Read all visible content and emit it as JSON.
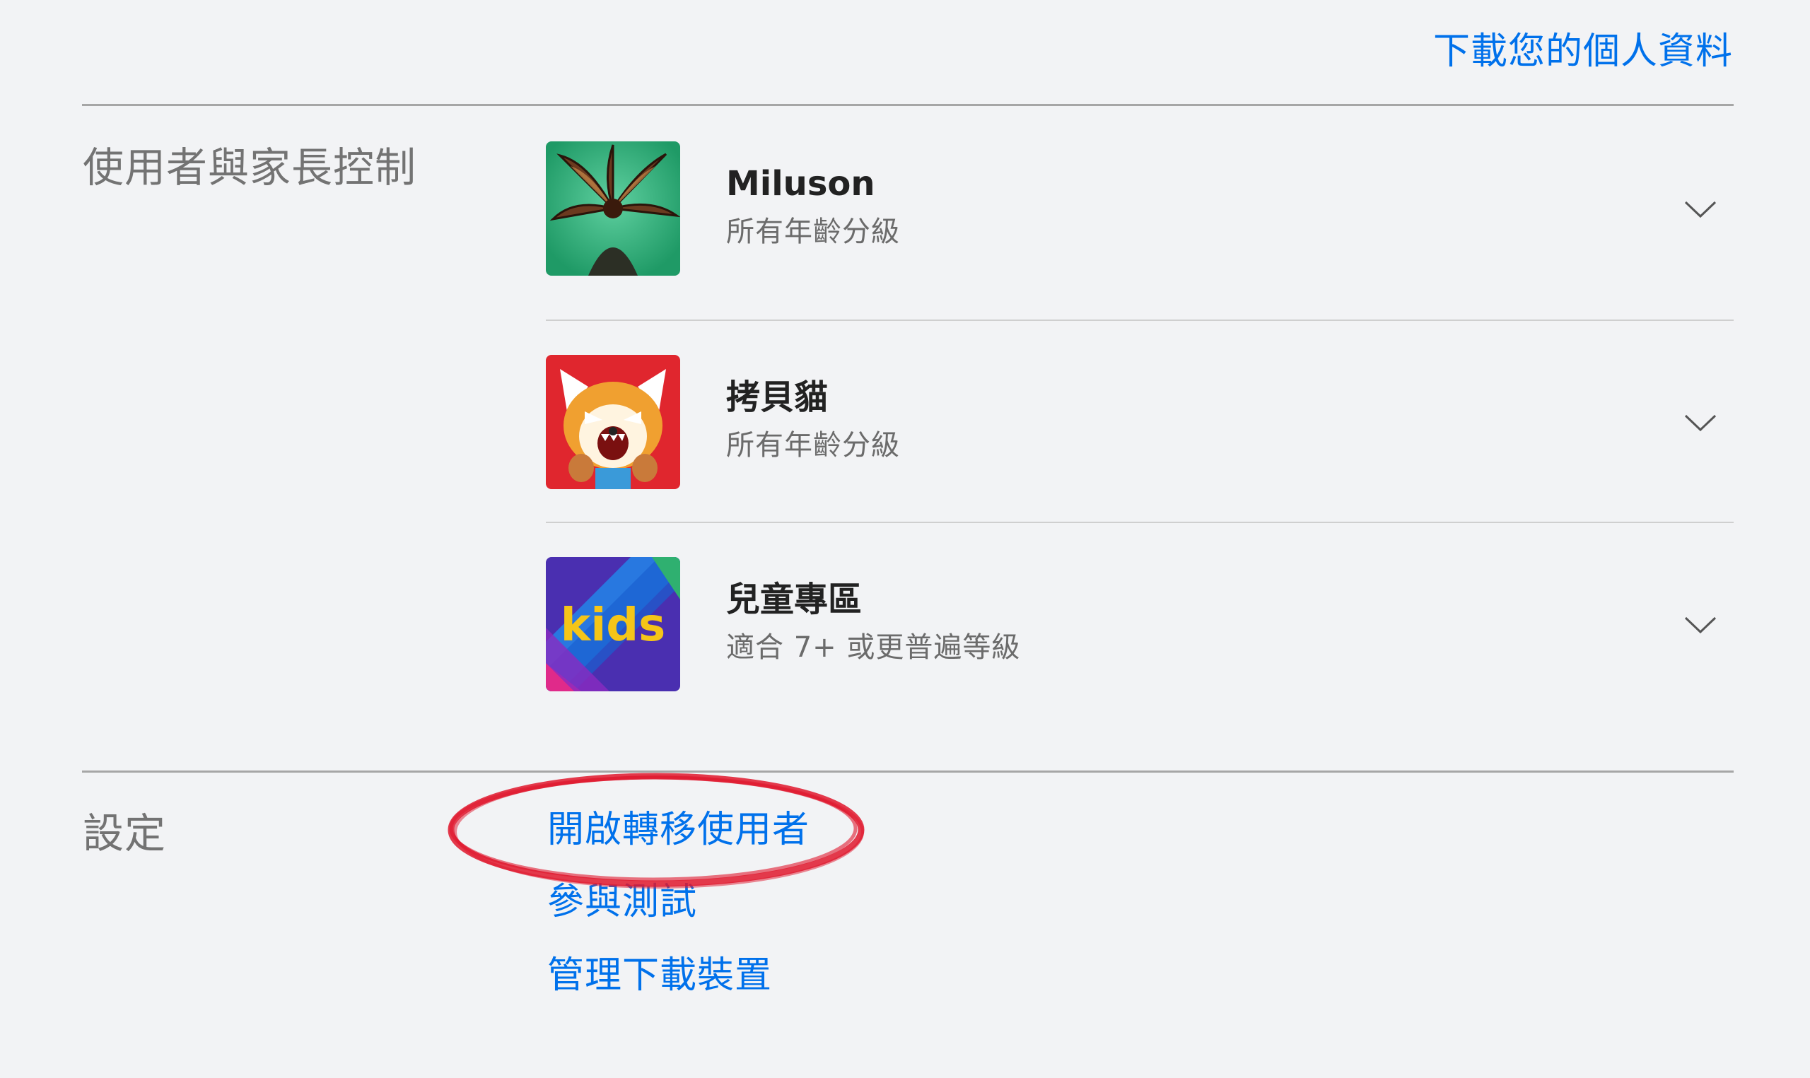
{
  "header": {
    "download_link": "下載您的個人資料"
  },
  "profiles_section": {
    "label": "使用者與家長控制",
    "profiles": [
      {
        "name": "Miluson",
        "rating": "所有年齡分級",
        "avatar": "monster-avatar"
      },
      {
        "name": "拷貝貓",
        "rating": "所有年齡分級",
        "avatar": "red-panda-avatar"
      },
      {
        "name": "兒童專區",
        "rating": "適合 7+ 或更普遍等級",
        "avatar": "kids-avatar",
        "avatar_text": "kids"
      }
    ]
  },
  "settings_section": {
    "label": "設定",
    "links": [
      "開啟轉移使用者",
      "參與測試",
      "管理下載裝置"
    ]
  },
  "colors": {
    "link": "#0071eb",
    "background": "#f2f3f5",
    "highlight": "#e0182d"
  }
}
